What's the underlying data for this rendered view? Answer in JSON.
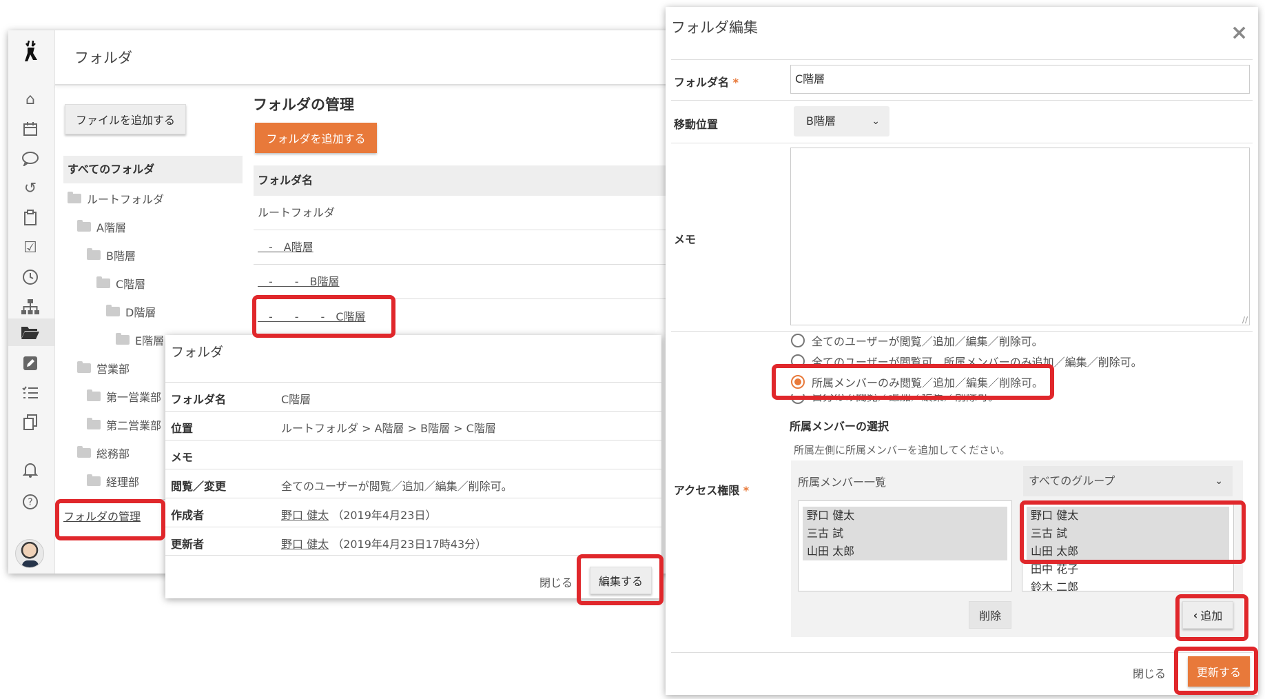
{
  "main": {
    "title": "フォルダ",
    "add_file_button": "ファイルを追加する",
    "manage_heading": "フォルダの管理",
    "add_folder_button": "フォルダを追加する",
    "table_header": "フォルダ名",
    "rows": [
      "ルートフォルダ",
      "　-　A階層",
      "　-　　-　B階層",
      "　-　　-　　-　C階層"
    ],
    "manage_link": "フォルダの管理"
  },
  "tree": {
    "all": "すべてのフォルダ",
    "items": [
      "ルートフォルダ",
      "A階層",
      "B階層",
      "C階層",
      "D階層",
      "E階層",
      "営業部",
      "第一営業部",
      "第二営業部",
      "総務部",
      "経理部"
    ]
  },
  "detail": {
    "title": "フォルダ",
    "labels": [
      "フォルダ名",
      "位置",
      "メモ",
      "閲覧／変更",
      "作成者",
      "更新者"
    ],
    "name_value": "C階層",
    "location_value": "ルートフォルダ > A階層 > B階層 > C階層",
    "memo_value": "",
    "access_value": "全てのユーザーが閲覧／追加／編集／削除可。",
    "creator_name": "野口 健太",
    "creator_date": "（2019年4月23日）",
    "updater_name": "野口 健太",
    "updater_date": "（2019年4月23日17時43分）",
    "close_label": "閉じる",
    "edit_label": "編集する"
  },
  "edit": {
    "title": "フォルダ編集",
    "close_icon": "×",
    "name_label": "フォルダ名",
    "name_value": "C階層",
    "required_mark": "*",
    "move_label": "移動位置",
    "move_value": "B階層",
    "memo_label": "メモ",
    "access_label": "アクセス権限",
    "radio_options": [
      "全てのユーザーが閲覧／追加／編集／削除可。",
      "全てのユーザーが閲覧可、所属メンバーのみ追加／編集／削除可。",
      "所属メンバーのみ閲覧／追加／編集／削除可。",
      "自分のみ閲覧／追加／編集／削除可。"
    ],
    "selected_radio": 2,
    "members_heading": "所属メンバーの選択",
    "members_hint": "所属左側に所属メンバーを追加してください。",
    "member_list_label": "所属メンバー一覧",
    "group_select": "すべてのグループ",
    "left_members": [
      "野口 健太",
      "三古 試",
      "山田 太郎"
    ],
    "right_members": [
      "野口 健太",
      "三古 試",
      "山田 太郎",
      "田中 花子",
      "鈴木 二郎"
    ],
    "delete_label": "削除",
    "add_label": "追加",
    "close_label": "閉じる",
    "update_label": "更新する"
  },
  "colors": {
    "accent": "#e8793a",
    "annotation": "#e0272b"
  },
  "icons": [
    "deer-logo-icon",
    "home-icon",
    "calendar-icon",
    "chat-icon",
    "history-icon",
    "clipboard-icon",
    "checkbox-icon",
    "clock-icon",
    "org-chart-icon",
    "folder-open-icon",
    "edit-icon",
    "list-icon",
    "copy-icon",
    "bell-icon",
    "help-icon",
    "avatar"
  ]
}
